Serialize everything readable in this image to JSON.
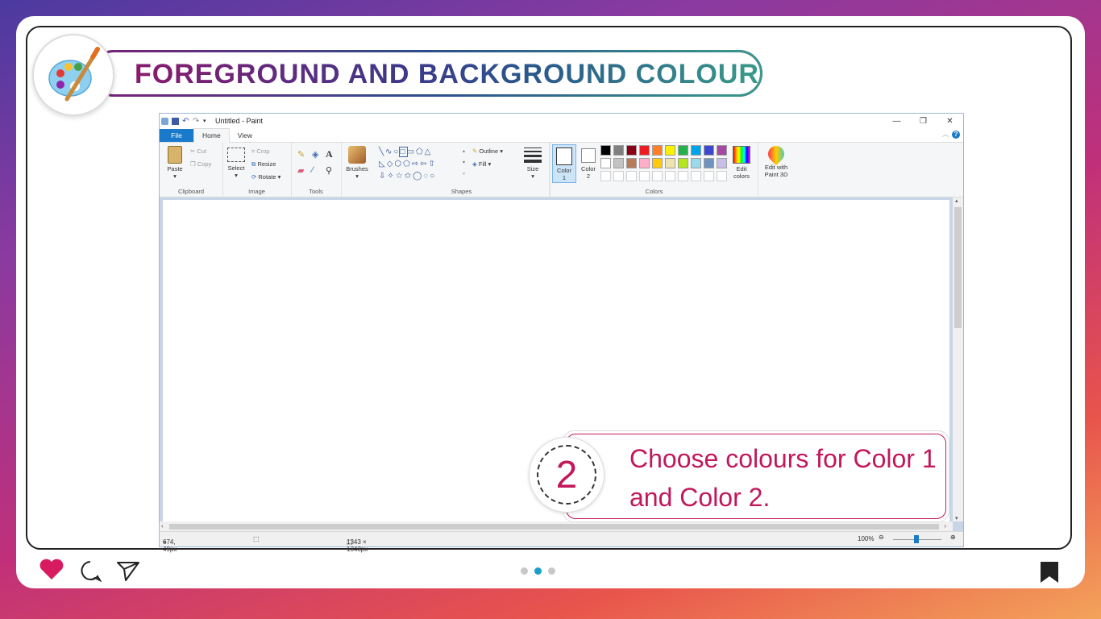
{
  "header": {
    "title": "FOREGROUND AND BACKGROUND COLOUR"
  },
  "paint": {
    "window_title": "Untitled - Paint",
    "tabs": [
      "File",
      "Home",
      "View"
    ],
    "clipboard": {
      "paste": "Paste",
      "cut": "Cut",
      "copy": "Copy",
      "label": "Clipboard"
    },
    "image": {
      "select": "Select",
      "crop": "Crop",
      "resize": "Resize",
      "rotate": "Rotate",
      "label": "Image"
    },
    "tools": {
      "label": "Tools"
    },
    "brushes": {
      "label": "Brushes"
    },
    "shapes": {
      "outline": "Outline",
      "fill": "Fill",
      "label": "Shapes"
    },
    "size": {
      "label": "Size"
    },
    "colors": {
      "color1": "Color 1",
      "color2": "Color 2",
      "edit": "Edit colors",
      "label": "Colors",
      "row1": [
        "#000000",
        "#7f7f7f",
        "#880015",
        "#ed1c24",
        "#ff7f27",
        "#fff200",
        "#22b14c",
        "#00a2e8",
        "#3f48cc",
        "#a349a4"
      ],
      "row2": [
        "#ffffff",
        "#c3c3c3",
        "#b97a57",
        "#ffaec9",
        "#ffc90e",
        "#efe4b0",
        "#b5e61d",
        "#99d9ea",
        "#7092be",
        "#c8bfe7"
      ]
    },
    "paint3d": "Edit with Paint 3D",
    "status": {
      "cursor": "674, 49px",
      "canvas_size": "1343 × 1343px",
      "zoom": "100%"
    }
  },
  "callout": {
    "number": "2",
    "text": "Choose colours for Color 1 and Color 2."
  },
  "pager": {
    "pages": 3,
    "active": 1
  }
}
